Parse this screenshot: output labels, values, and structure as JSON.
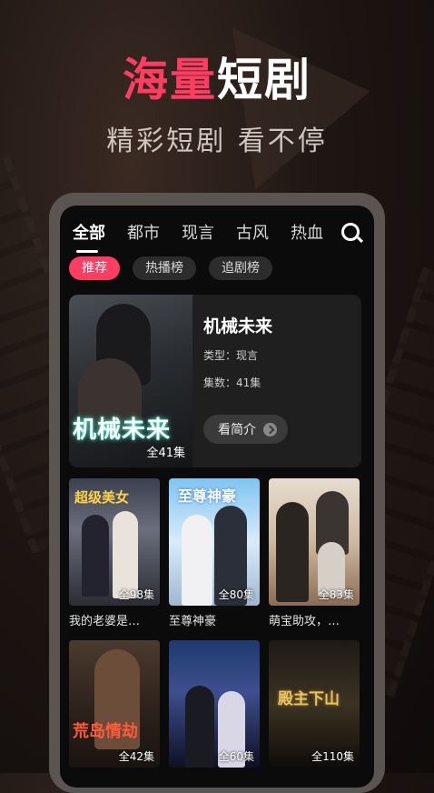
{
  "headline": {
    "part1": "海量",
    "part2": "短剧"
  },
  "subheadline": "精彩短剧 看不停",
  "tabs": [
    {
      "label": "全部",
      "active": true
    },
    {
      "label": "都市",
      "active": false
    },
    {
      "label": "现言",
      "active": false
    },
    {
      "label": "古风",
      "active": false
    },
    {
      "label": "热血",
      "active": false
    }
  ],
  "search_icon": "search-icon",
  "chips": [
    {
      "label": "推荐",
      "active": true
    },
    {
      "label": "热播榜",
      "active": false
    },
    {
      "label": "追剧榜",
      "active": false
    }
  ],
  "featured": {
    "poster_title": "机械未来",
    "episode_count": "全41集",
    "title": "机械未来",
    "type_label": "类型：现言",
    "episodes_label": "集数：41集",
    "intro_button": "看简介"
  },
  "cards": [
    {
      "title": "我的老婆是…",
      "episodes": "全98集",
      "poster_text": "超级美女"
    },
    {
      "title": "至尊神豪",
      "episodes": "全80集",
      "poster_text": "至尊神豪"
    },
    {
      "title": "萌宝助攻，…",
      "episodes": "全83集",
      "poster_text": ""
    },
    {
      "title": "",
      "episodes": "全42集",
      "poster_text": "荒岛情劫"
    },
    {
      "title": "",
      "episodes": "全60集",
      "poster_text": ""
    },
    {
      "title": "",
      "episodes": "全110集",
      "poster_text": "殿主下山"
    }
  ],
  "colors": {
    "accent": "#ff3d63",
    "background": "#0b0b0b"
  }
}
